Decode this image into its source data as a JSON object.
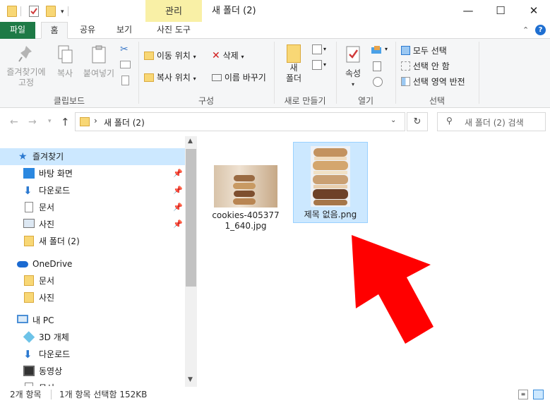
{
  "window": {
    "context_tab": "관리",
    "title": "새 폴더 (2)",
    "minimize": "—",
    "maximize": "☐",
    "close": "✕"
  },
  "tabs": [
    "파일",
    "홈",
    "공유",
    "보기",
    "사진 도구"
  ],
  "ribbon": {
    "clipboard": {
      "pin_label": "즐겨찾기에\n고정",
      "copy_label": "복사",
      "paste_label": "붙여넣기",
      "group": "클립보드"
    },
    "organize": {
      "move_to": "이동 위치",
      "copy_to": "복사 위치",
      "delete": "삭제",
      "rename": "이름 바꾸기",
      "group": "구성"
    },
    "new": {
      "new_folder": "새\n폴더",
      "group": "새로 만들기"
    },
    "open": {
      "properties": "속성",
      "group": "열기"
    },
    "select": {
      "select_all": "모두 선택",
      "select_none": "선택 안 함",
      "invert": "선택 영역 반전",
      "group": "선택"
    }
  },
  "address": {
    "breadcrumb": "새 폴더 (2)",
    "search_placeholder": "새 폴더 (2) 검색"
  },
  "nav": {
    "quick_access": "즐겨찾기",
    "quick_items": [
      "바탕 화면",
      "다운로드",
      "문서",
      "사진",
      "새 폴더 (2)"
    ],
    "onedrive": "OneDrive",
    "onedrive_items": [
      "문서",
      "사진"
    ],
    "pc": "내 PC",
    "pc_items": [
      "3D 개체",
      "다운로드",
      "동영상",
      "문서"
    ]
  },
  "files": [
    {
      "name": "cookies-405377\n1_640.jpg",
      "selected": false
    },
    {
      "name": "제목 없음.png",
      "selected": true
    }
  ],
  "status": {
    "count": "2개 항목",
    "selection": "1개 항목 선택함 152KB"
  },
  "colors": {
    "file_tab": "#1e7a46",
    "context_tab": "#f9f0a6",
    "selection": "#cce8ff",
    "arrow": "#ff0000"
  }
}
